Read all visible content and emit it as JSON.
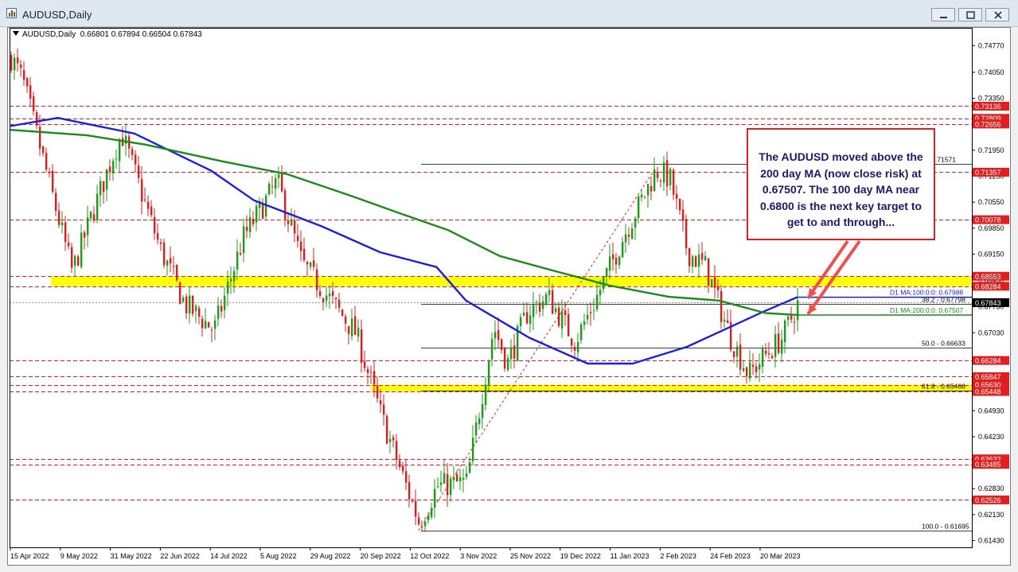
{
  "window": {
    "title": "AUDUSD,Daily"
  },
  "info_line": {
    "symbol": "AUDUSD,Daily",
    "ohlc": "0.66801 0.67894 0.66504 0.67843"
  },
  "annotation": "The AUDUSD moved above the 200 day MA (now close risk) at 0.67507. The 100 day MA near 0.6800 is the next key target to get to and through...",
  "colors": {
    "up_candle": "#1a9e1a",
    "down_candle": "#e01c1c",
    "ma100": "#1f1fd6",
    "ma200": "#1a8a1a",
    "support_zone": "#ffff00",
    "level_line": "#e02020",
    "current_price": "#000000"
  },
  "chart_data": {
    "type": "candlestick",
    "symbol": "AUDUSD",
    "timeframe": "Daily",
    "x_tick_labels": [
      "15 Apr 2022",
      "9 May 2022",
      "31 May 2022",
      "22 Jun 2022",
      "14 Jul 2022",
      "5 Aug 2022",
      "29 Aug 2022",
      "20 Sep 2022",
      "12 Oct 2022",
      "3 Nov 2022",
      "25 Nov 2022",
      "19 Dec 2022",
      "11 Jan 2023",
      "2 Feb 2023",
      "24 Feb 2023",
      "20 Mar 2023"
    ],
    "y_tick_labels": [
      "0.74770",
      "0.74050",
      "0.73350",
      "0.72630",
      "0.71950",
      "0.71250",
      "0.70550",
      "0.69850",
      "0.69150",
      "0.68450",
      "0.67730",
      "0.67030",
      "0.66330",
      "0.65630",
      "0.64930",
      "0.64230",
      "0.63530",
      "0.62830",
      "0.62130",
      "0.61430"
    ],
    "ylim": [
      0.6127,
      0.7499
    ],
    "price_path": {
      "dates": [
        "2022-04-15",
        "2022-04-20",
        "2022-05-03",
        "2022-05-12",
        "2022-05-30",
        "2022-06-03",
        "2022-06-20",
        "2022-07-01",
        "2022-07-14",
        "2022-07-27",
        "2022-08-11",
        "2022-08-22",
        "2022-09-05",
        "2022-09-15",
        "2022-09-26",
        "2022-10-13",
        "2022-10-21",
        "2022-11-03",
        "2022-11-15",
        "2022-11-21",
        "2022-11-30",
        "2022-12-09",
        "2022-12-21",
        "2022-12-30",
        "2023-01-12",
        "2023-01-26",
        "2023-02-01",
        "2023-02-09",
        "2023-02-17",
        "2023-02-28",
        "2023-03-08",
        "2023-03-15",
        "2023-03-23",
        "2023-03-30"
      ],
      "closes": [
        0.7445,
        0.7386,
        0.708,
        0.6868,
        0.718,
        0.724,
        0.693,
        0.678,
        0.671,
        0.696,
        0.711,
        0.689,
        0.678,
        0.67,
        0.648,
        0.619,
        0.629,
        0.63,
        0.672,
        0.662,
        0.676,
        0.68,
        0.668,
        0.679,
        0.697,
        0.714,
        0.712,
        0.692,
        0.688,
        0.669,
        0.659,
        0.664,
        0.669,
        0.6784
      ]
    },
    "moving_averages": [
      {
        "name": "MA:100:0:0",
        "value": 0.67988,
        "label": "D1 MA:100:0:0: 0.67988",
        "dates": [
          "2022-04-15",
          "2022-05-06",
          "2022-06-09",
          "2022-07-13",
          "2022-08-01",
          "2022-08-31",
          "2022-09-26",
          "2022-10-21",
          "2022-11-03",
          "2022-12-01",
          "2022-12-27",
          "2023-01-16",
          "2023-02-09",
          "2023-03-15",
          "2023-03-30"
        ],
        "values": [
          0.726,
          0.7282,
          0.724,
          0.714,
          0.706,
          0.699,
          0.692,
          0.688,
          0.679,
          0.669,
          0.662,
          0.662,
          0.6665,
          0.676,
          0.6799
        ]
      },
      {
        "name": "MA:200:0:0",
        "value": 0.67507,
        "label": "D1 MA:200:0:0: 0.67507",
        "dates": [
          "2022-04-15",
          "2022-05-19",
          "2022-06-14",
          "2022-07-18",
          "2022-08-16",
          "2022-09-14",
          "2022-10-07",
          "2022-10-26",
          "2022-11-18",
          "2022-12-12",
          "2023-01-06",
          "2023-02-01",
          "2023-02-23",
          "2023-03-16",
          "2023-03-30"
        ],
        "values": [
          0.725,
          0.7235,
          0.721,
          0.7165,
          0.713,
          0.707,
          0.702,
          0.698,
          0.691,
          0.687,
          0.683,
          0.68,
          0.679,
          0.6756,
          0.6751
        ]
      }
    ],
    "fibonacci": {
      "swing_low": 0.61695,
      "swing_high": 0.71571,
      "levels": [
        {
          "label": "0 - 0.71571",
          "value": 0.71571
        },
        {
          "label": "38.2 - 0.67798",
          "value": 0.67798
        },
        {
          "label": "50.0 - 0.66633",
          "value": 0.66633
        },
        {
          "label": "61.8 - 0.65468",
          "value": 0.65468
        },
        {
          "label": "100.0 - 0.61695",
          "value": 0.61695
        }
      ]
    },
    "horizontal_levels": [
      0.73136,
      0.72809,
      0.72656,
      0.71357,
      0.70078,
      0.68553,
      0.68284,
      0.66284,
      0.65847,
      0.6563,
      0.65448,
      0.63633,
      0.63485,
      0.62526
    ],
    "price_axis_labels": [
      "0.73136",
      "0.72809",
      "0.72656",
      "0.71357",
      "0.70078",
      "0.68553",
      "0.68284",
      "0.66284",
      "0.65847",
      "0.65630",
      "0.65448",
      "0.63633",
      "0.63485",
      "0.62526"
    ],
    "support_zones": [
      [
        0.68284,
        0.68553
      ],
      [
        0.65448,
        0.6563
      ]
    ],
    "current_price": 0.67843,
    "current_price_label": "0.67843",
    "trendline_from_date": "2022-10-13",
    "trendline_from_value": 0.617,
    "trendline_to_date": "2023-01-26",
    "trendline_to_value": 0.7146,
    "grid": false
  }
}
